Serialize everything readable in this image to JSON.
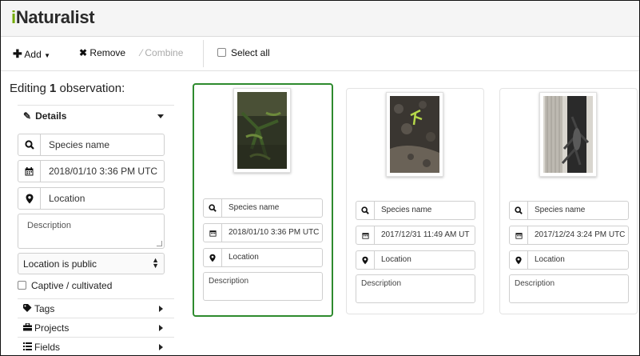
{
  "app": {
    "logo_i": "i",
    "logo_rest": "Naturalist"
  },
  "toolbar": {
    "add_label": "Add",
    "remove_label": "Remove",
    "combine_label": "Combine",
    "select_all_label": "Select all"
  },
  "sidebar": {
    "editing_prefix": "Editing ",
    "editing_count": "1",
    "editing_suffix": " observation:",
    "details_label": "Details",
    "species_placeholder": "Species name",
    "date_value": "2018/01/10 3:36 PM UTC",
    "location_placeholder": "Location",
    "description_placeholder": "Description",
    "privacy_value": "Location is public",
    "captive_label": "Captive / cultivated",
    "tags_label": "Tags",
    "projects_label": "Projects",
    "fields_label": "Fields"
  },
  "cards": [
    {
      "selected": true,
      "species_placeholder": "Species name",
      "date": "2018/01/10 3:36 PM UTC",
      "location_placeholder": "Location",
      "description_placeholder": "Description"
    },
    {
      "selected": false,
      "species_placeholder": "Species name",
      "date": "2017/12/31 11:49 AM UT",
      "location_placeholder": "Location",
      "description_placeholder": "Description"
    },
    {
      "selected": false,
      "species_placeholder": "Species name",
      "date": "2017/12/24 3:24 PM UTC",
      "location_placeholder": "Location",
      "description_placeholder": "Description"
    }
  ],
  "colors": {
    "brand_green": "#74ac00",
    "selected_border": "#2e8b2e"
  }
}
